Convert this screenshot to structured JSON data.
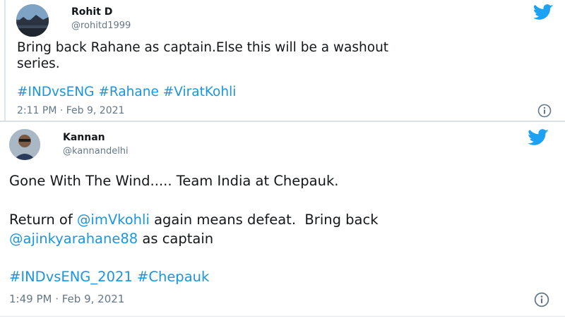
{
  "tweets": [
    {
      "name": "Rohit D",
      "handle": "@rohitd1999",
      "text": "Bring back Rahane as captain.Else this will be a washout",
      "text2": "series.",
      "hashtags": [
        "#INDvsENG",
        "#Rahane",
        "#ViratKohli"
      ],
      "timestamp": "2:11 PM · Feb 9, 2021"
    },
    {
      "name": "Kannan",
      "handle": "@kannandelhi",
      "line1": "Gone With The Wind..... Team India at Chepauk.",
      "line2_pre": "Return of ",
      "line2_mention": "@imVkohli",
      "line2_post": " again means defeat.  Bring back",
      "line3_mention": "@ajinkyarahane88",
      "line3_post": " as captain",
      "hashtags": [
        "#INDvsENG_2021",
        "#Chepauk"
      ],
      "timestamp": "1:49 PM · Feb 9, 2021"
    }
  ],
  "icons": {
    "brand": "twitter-bird-icon",
    "info": "info-circle-icon",
    "brand_color": "#1da1f2",
    "link_color": "#1b95e0",
    "meta_color": "#657786"
  }
}
